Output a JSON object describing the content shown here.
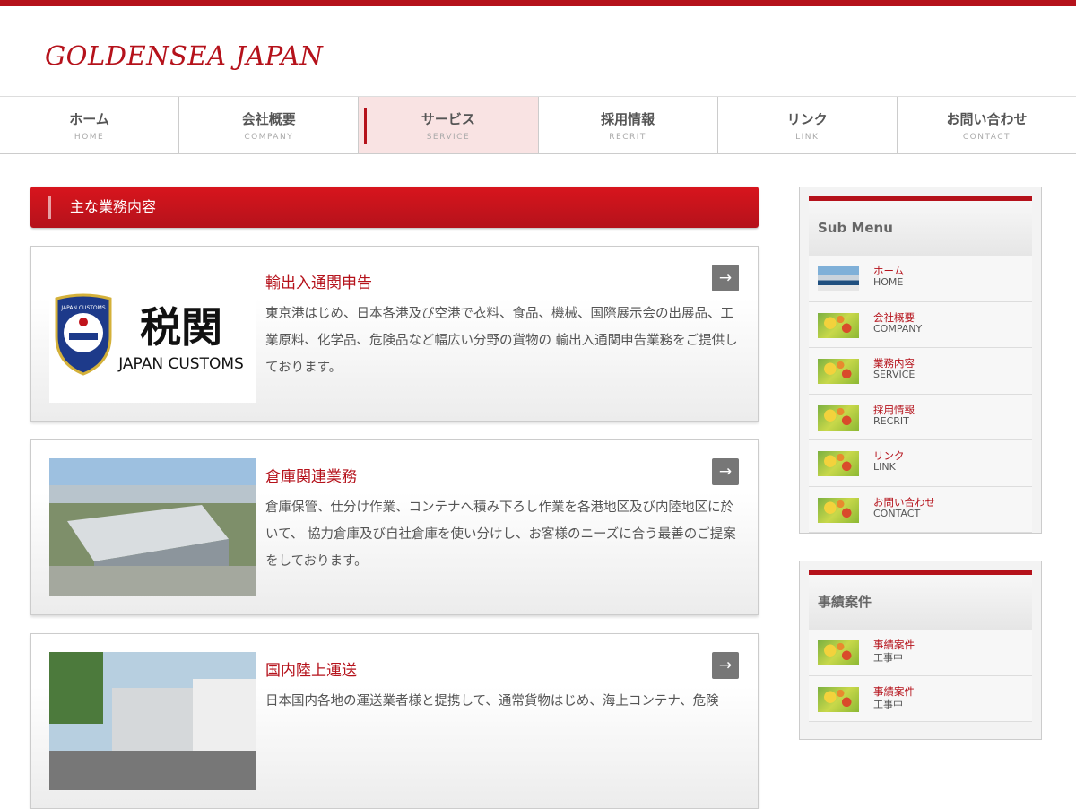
{
  "header": {
    "logo": "GOLDENSEA JAPAN"
  },
  "nav": [
    {
      "jp": "ホーム",
      "en": "HOME"
    },
    {
      "jp": "会社概要",
      "en": "COMPANY"
    },
    {
      "jp": "サービス",
      "en": "SERVICE"
    },
    {
      "jp": "採用情報",
      "en": "RECRIT"
    },
    {
      "jp": "リンク",
      "en": "LINK"
    },
    {
      "jp": "お問い合わせ",
      "en": "CONTACT"
    }
  ],
  "main": {
    "title": "主な業務内容",
    "arrow": "→",
    "cards": [
      {
        "title": "輸出入通関申告",
        "text": "東京港はじめ、日本各港及び空港で衣料、食品、機械、国際展示会の出展品、工業原料、化学品、危険品など幅広い分野の貨物の 輸出入通関申告業務をご提供しております。",
        "logo_kanji": "税関",
        "logo_en": "JAPAN CUSTOMS",
        "badge": "JAPAN CUSTOMS"
      },
      {
        "title": "倉庫関連業務",
        "text": "倉庫保管、仕分け作業、コンテナへ積み下ろし作業を各港地区及び内陸地区に於いて、 協力倉庫及び自社倉庫を使い分けし、お客様のニーズに合う最善のご提案をしております。"
      },
      {
        "title": "国内陸上運送",
        "text": "日本国内各地の運送業者様と提携して、通常貨物はじめ、海上コンテナ、危険"
      }
    ]
  },
  "sidebar": {
    "submenu_title": "Sub Menu",
    "submenu": [
      {
        "jp": "ホーム",
        "en": "HOME"
      },
      {
        "jp": "会社概要",
        "en": "COMPANY"
      },
      {
        "jp": "業務内容",
        "en": "SERVICE"
      },
      {
        "jp": "採用情報",
        "en": "RECRIT"
      },
      {
        "jp": "リンク",
        "en": "LINK"
      },
      {
        "jp": "お問い合わせ",
        "en": "CONTACT"
      }
    ],
    "cases_title": "事績案件",
    "cases": [
      {
        "jp": "事績案件",
        "en": "工事中"
      },
      {
        "jp": "事績案件",
        "en": "工事中"
      }
    ]
  },
  "colors": {
    "accent": "#b5121b",
    "active_tab_bg": "#f9e3e3"
  }
}
